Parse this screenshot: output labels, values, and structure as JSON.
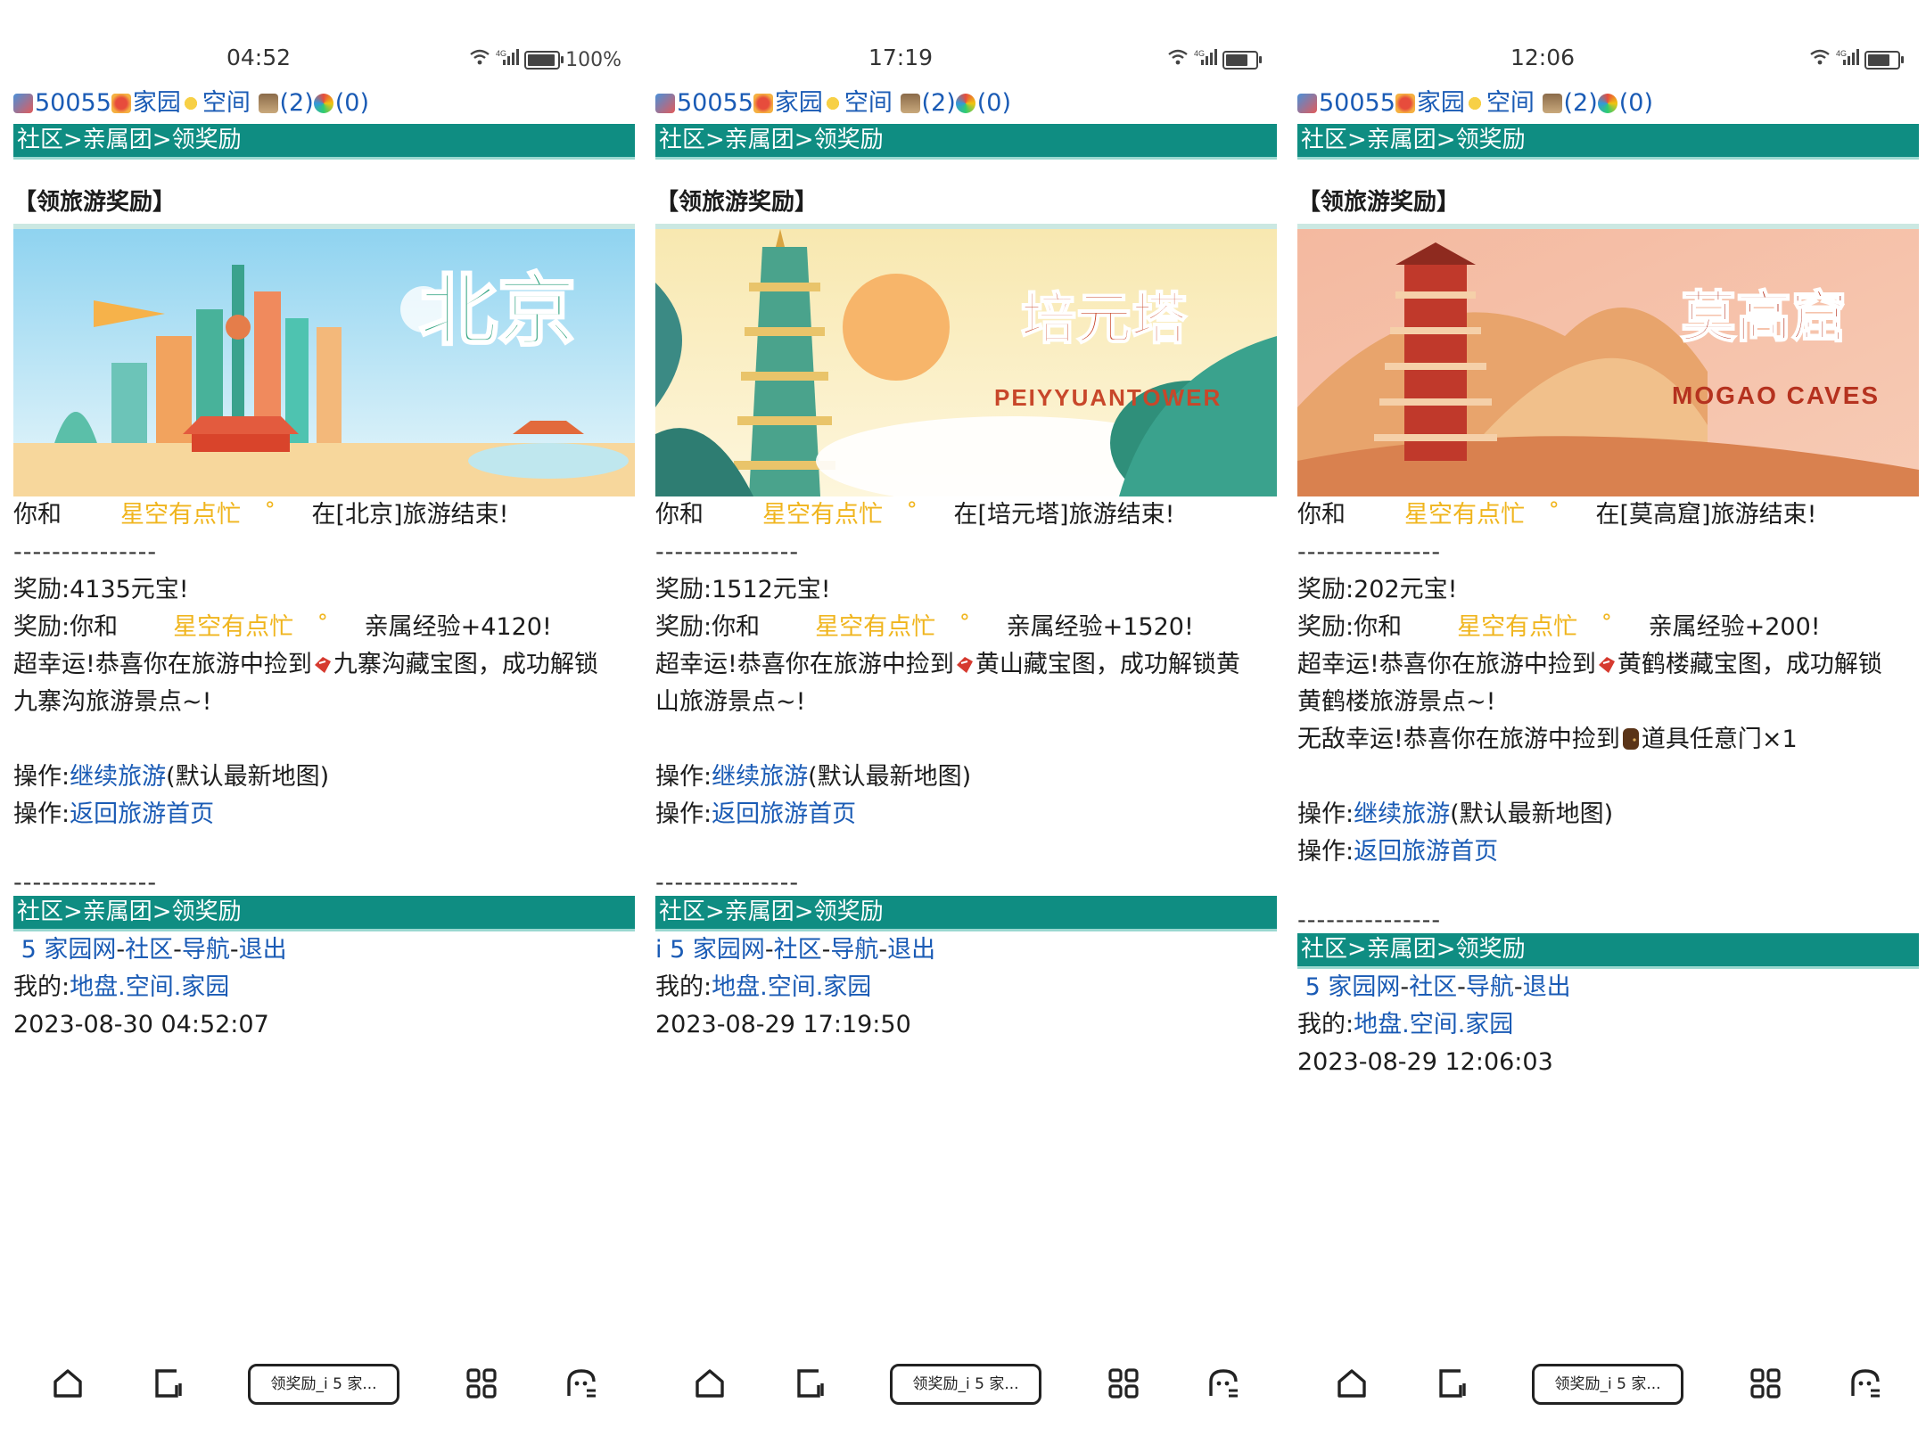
{
  "panels": [
    {
      "status": {
        "time": "04:52",
        "battery": "100%",
        "battery_level": 1.0
      },
      "topline": {
        "id": "50055",
        "home": "家园",
        "space": "空间",
        "count1": "(2)",
        "count2": "(0)"
      },
      "breadcrumb": "社区>亲属团>领奖励",
      "section_title": "【领旅游奖励】",
      "banner": {
        "title": "北京",
        "subtitle": ""
      },
      "trip": {
        "you_and": "你和",
        "friend": "星空有点忙",
        "mark": "˚",
        "ended": "在[北京]旅游结束!"
      },
      "divider": "---------------",
      "reward_coins": "奖励:4135元宝!",
      "reward_exp": {
        "prefix": "奖励:你和",
        "friend": "星空有点忙",
        "mark": "˚",
        "exp": "亲属经验+4120!"
      },
      "lucky_line1": "超幸运!恭喜你在旅游中捡到",
      "lucky_line1b": "九寨沟藏宝图，成功解锁",
      "lucky_line2": "九寨沟旅游景点~!",
      "extra_lucky": "",
      "op1": {
        "label": "操作:",
        "link": "继续旅游",
        "note": "(默认最新地图)"
      },
      "op2": {
        "label": "操作:",
        "link": "返回旅游首页"
      },
      "divider2": "---------------",
      "footer_nav": "社区>亲属团>领奖励",
      "footer_links": {
        "a": "5 家园网",
        "b": "社区",
        "c": "导航",
        "d": "退出",
        "prefix": " "
      },
      "my": {
        "label": "我的:",
        "a": "地盘",
        "b": "空间",
        "c": "家园"
      },
      "timestamp": "2023-08-30 04:52:07",
      "tab_label": "领奖励_i 5 家..."
    },
    {
      "status": {
        "time": "17:19",
        "battery": "",
        "battery_level": 0.8
      },
      "topline": {
        "id": "50055",
        "home": "家园",
        "space": "空间",
        "count1": "(2)",
        "count2": "(0)"
      },
      "breadcrumb": "社区>亲属团>领奖励",
      "section_title": "【领旅游奖励】",
      "banner": {
        "title": "培元塔",
        "subtitle": "PEIYYUANTOWER"
      },
      "trip": {
        "you_and": "你和",
        "friend": "星空有点忙",
        "mark": "˚",
        "ended": "在[培元塔]旅游结束!"
      },
      "divider": "---------------",
      "reward_coins": "奖励:1512元宝!",
      "reward_exp": {
        "prefix": "奖励:你和",
        "friend": "星空有点忙",
        "mark": "˚",
        "exp": "亲属经验+1520!"
      },
      "lucky_line1": "超幸运!恭喜你在旅游中捡到",
      "lucky_line1b": "黄山藏宝图，成功解锁黄",
      "lucky_line2": "山旅游景点~!",
      "extra_lucky": "",
      "op1": {
        "label": "操作:",
        "link": "继续旅游",
        "note": "(默认最新地图)"
      },
      "op2": {
        "label": "操作:",
        "link": "返回旅游首页"
      },
      "divider2": "---------------",
      "footer_nav": "社区>亲属团>领奖励",
      "footer_links": {
        "a": "5 家园网",
        "b": "社区",
        "c": "导航",
        "d": "退出",
        "prefix": "i "
      },
      "my": {
        "label": "我的:",
        "a": "地盘",
        "b": "空间",
        "c": "家园"
      },
      "timestamp": "2023-08-29 17:19:50",
      "tab_label": "领奖励_i 5 家..."
    },
    {
      "status": {
        "time": "12:06",
        "battery": "",
        "battery_level": 0.8
      },
      "topline": {
        "id": "50055",
        "home": "家园",
        "space": "空间",
        "count1": "(2)",
        "count2": "(0)"
      },
      "breadcrumb": "社区>亲属团>领奖励",
      "section_title": "【领旅游奖励】",
      "banner": {
        "title": "莫高窟",
        "subtitle": "MOGAO CAVES"
      },
      "trip": {
        "you_and": "你和",
        "friend": "星空有点忙",
        "mark": "˚",
        "ended": "在[莫高窟]旅游结束!"
      },
      "divider": "---------------",
      "reward_coins": "奖励:202元宝!",
      "reward_exp": {
        "prefix": "奖励:你和",
        "friend": "星空有点忙",
        "mark": "˚",
        "exp": "亲属经验+200!"
      },
      "lucky_line1": "超幸运!恭喜你在旅游中捡到",
      "lucky_line1b": "黄鹤楼藏宝图，成功解锁",
      "lucky_line2": "黄鹤楼旅游景点~!",
      "extra_lucky": {
        "prefix": "无敌幸运!恭喜你在旅游中捡到",
        "item": "道具任意门×1"
      },
      "op1": {
        "label": "操作:",
        "link": "继续旅游",
        "note": "(默认最新地图)"
      },
      "op2": {
        "label": "操作:",
        "link": "返回旅游首页"
      },
      "divider2": "---------------",
      "footer_nav": "社区>亲属团>领奖励",
      "footer_links": {
        "a": "5 家园网",
        "b": "社区",
        "c": "导航",
        "d": "退出",
        "prefix": " "
      },
      "my": {
        "label": "我的:",
        "a": "地盘",
        "b": "空间",
        "c": "家园"
      },
      "timestamp": "2023-08-29 12:06:03",
      "tab_label": "领奖励_i 5 家..."
    }
  ],
  "colors": {
    "nav_bg": "#0f8d82",
    "link": "#1a5bb5",
    "friend": "#f0b51e"
  },
  "icons": {
    "home": "home-icon",
    "notes": "notes-icon",
    "grid": "grid-icon",
    "ghost": "ghost-icon",
    "map_item": "treasure-map-icon",
    "door_item": "door-icon"
  }
}
